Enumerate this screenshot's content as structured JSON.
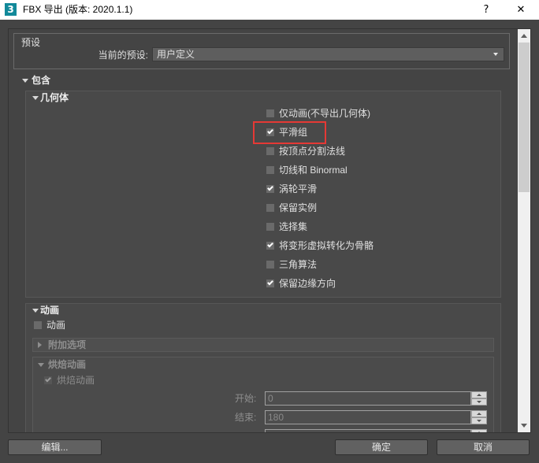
{
  "window": {
    "title": "FBX 导出 (版本: 2020.1.1)",
    "icon_glyph": "3",
    "help_label": "?",
    "close_label": "✕"
  },
  "presets": {
    "group_label": "预设",
    "current_label": "当前的预设:",
    "current_value": "用户定义"
  },
  "include": {
    "label": "包含",
    "expanded": true,
    "geometry": {
      "label": "几何体",
      "expanded": true,
      "options": [
        {
          "label": "仅动画(不导出几何体)",
          "checked": false
        },
        {
          "label": "平滑组",
          "checked": true,
          "highlighted": true
        },
        {
          "label": "按顶点分割法线",
          "checked": false
        },
        {
          "label": "切线和 Binormal",
          "checked": false
        },
        {
          "label": "涡轮平滑",
          "checked": true
        },
        {
          "label": "保留实例",
          "checked": false
        },
        {
          "label": "选择集",
          "checked": false
        },
        {
          "label": "将变形虚拟转化为骨骼",
          "checked": true
        },
        {
          "label": "三角算法",
          "checked": false
        },
        {
          "label": "保留边缘方向",
          "checked": true
        }
      ]
    },
    "animation": {
      "label": "动画",
      "expanded": true,
      "animation_toggle": {
        "label": "动画",
        "checked": false
      },
      "extra_options": {
        "label": "附加选项",
        "expanded": false,
        "enabled": false
      },
      "bake_animation": {
        "label": "烘焙动画",
        "expanded": true,
        "enabled": false,
        "bake_toggle": {
          "label": "烘焙动画",
          "checked": true
        },
        "start": {
          "label": "开始:",
          "value": "0"
        },
        "end": {
          "label": "结束:",
          "value": "180"
        }
      }
    }
  },
  "footer": {
    "edit_label": "编辑...",
    "ok_label": "确定",
    "cancel_label": "取消"
  },
  "colors": {
    "dialog_bg": "#444444",
    "title_bar_bg": "#ffffff",
    "text": "#e0e0e0",
    "disabled_text": "#8e8e8e",
    "highlight": "#e53935",
    "app_icon": "#12899a"
  }
}
